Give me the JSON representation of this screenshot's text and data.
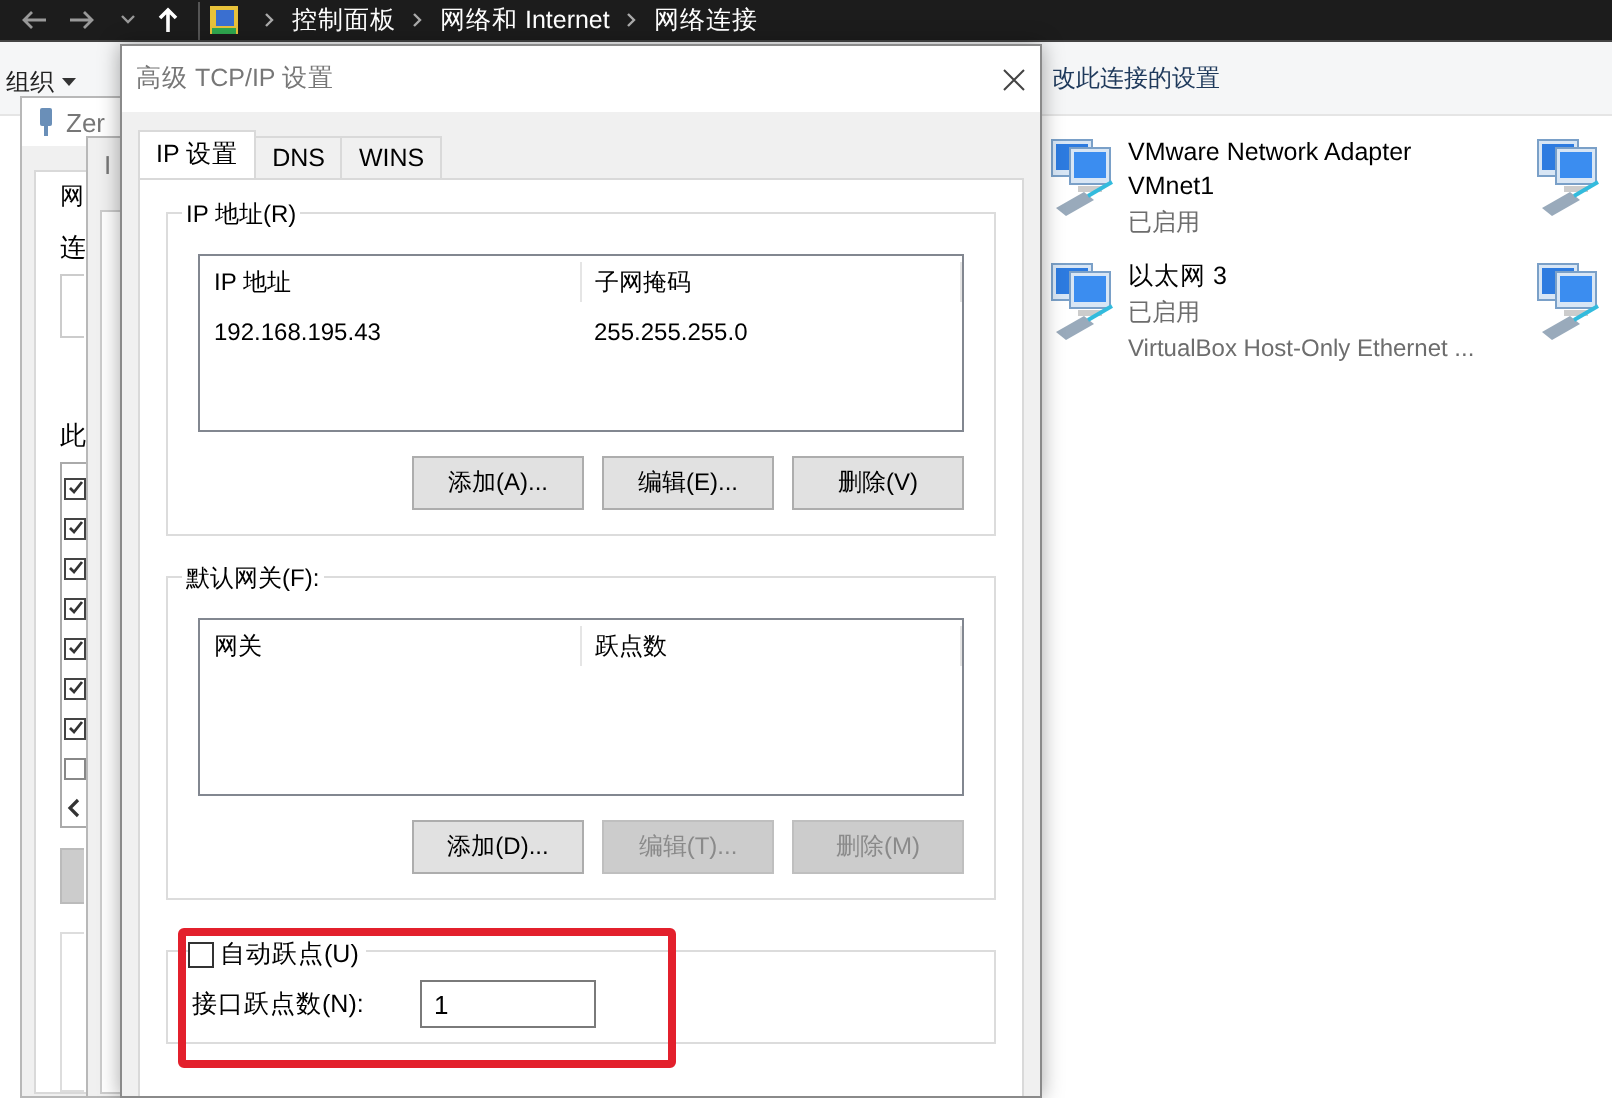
{
  "explorer": {
    "breadcrumbs": [
      "控制面板",
      "网络和 Internet",
      "网络连接"
    ],
    "organize": "组织",
    "command": "改此连接的设置",
    "adapters": [
      {
        "name": "VMware Network Adapter VMnet1",
        "status": "已启用"
      },
      {
        "name": "以太网 3",
        "status": "已启用",
        "device": "VirtualBox Host-Only Ethernet ..."
      }
    ]
  },
  "properties_window": {
    "title": "Zer",
    "tab": "网",
    "labels": [
      "连",
      "此"
    ],
    "items": [
      {
        "checked": true
      },
      {
        "checked": true
      },
      {
        "checked": true
      },
      {
        "checked": true
      },
      {
        "checked": true
      },
      {
        "checked": true
      },
      {
        "checked": true
      },
      {
        "checked": false
      }
    ]
  },
  "protocol_window": {
    "title": "I"
  },
  "dialog": {
    "title": "高级 TCP/IP 设置",
    "tabs": [
      {
        "label": "IP 设置",
        "selected": true
      },
      {
        "label": "DNS",
        "selected": false
      },
      {
        "label": "WINS",
        "selected": false
      }
    ],
    "ip_group": {
      "label": "IP 地址(R)",
      "columns": [
        "IP 地址",
        "子网掩码"
      ],
      "rows": [
        [
          "192.168.195.43",
          "255.255.255.0"
        ]
      ],
      "buttons": [
        {
          "label": "添加(A)...",
          "disabled": false
        },
        {
          "label": "编辑(E)...",
          "disabled": false
        },
        {
          "label": "删除(V)",
          "disabled": false
        }
      ]
    },
    "gateway_group": {
      "label": "默认网关(F):",
      "columns": [
        "网关",
        "跃点数"
      ],
      "buttons": [
        {
          "label": "添加(D)...",
          "disabled": false
        },
        {
          "label": "编辑(T)...",
          "disabled": true
        },
        {
          "label": "删除(M)",
          "disabled": true
        }
      ]
    },
    "metric": {
      "auto_label": "自动跃点(U)",
      "checked": false,
      "field_label": "接口跃点数(N):",
      "value": "1",
      "highlighted": true
    }
  }
}
